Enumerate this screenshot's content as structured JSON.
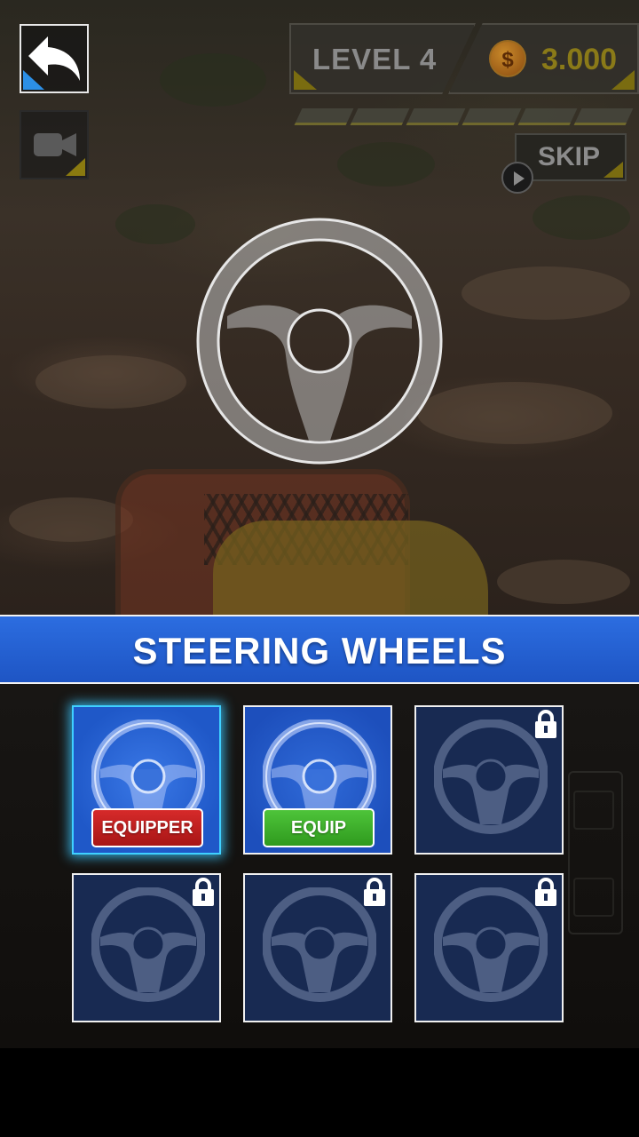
{
  "hud": {
    "back_icon": "undo-arrow-icon",
    "camera_icon": "video-camera-icon",
    "level_label": "LEVEL 4",
    "coin_symbol": "$",
    "coins": "3.000",
    "progress_segments": 6,
    "skip_label": "SKIP",
    "skip_icon": "play-icon"
  },
  "preview": {
    "icon": "steering-wheel-icon"
  },
  "section": {
    "title": "STEERING WHEELS"
  },
  "wheels": [
    {
      "state": "equipped",
      "button": "EQUIPPER"
    },
    {
      "state": "owned",
      "button": "EQUIP"
    },
    {
      "state": "locked"
    },
    {
      "state": "locked"
    },
    {
      "state": "locked"
    },
    {
      "state": "locked"
    }
  ],
  "colors": {
    "banner": "#2c6de0",
    "equipped_glow": "#3fd0ff",
    "equip_button": "#4ec43a",
    "equipper_button": "#d62a2a",
    "locked_tile": "#182a52"
  }
}
